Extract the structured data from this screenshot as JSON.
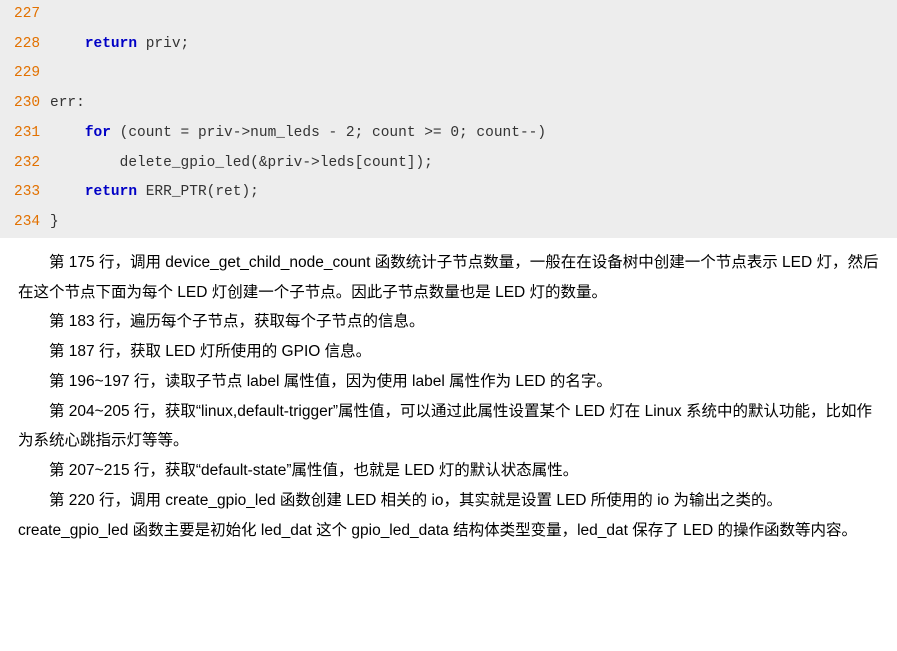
{
  "code": {
    "lines": [
      {
        "no": "227",
        "html": ""
      },
      {
        "no": "228",
        "html": "    <span class='kw'>return</span> priv;"
      },
      {
        "no": "229",
        "html": ""
      },
      {
        "no": "230",
        "html": "err:"
      },
      {
        "no": "231",
        "html": "    <span class='kw'>for</span> (count <span class='op'>=</span> priv<span class='op'>-&gt;</span>num_leds <span class='op'>-</span> 2; count <span class='op'>&gt;=</span> 0; count<span class='op'>--</span>)"
      },
      {
        "no": "232",
        "html": "        delete_gpio_led(<span class='op'>&amp;</span>priv<span class='op'>-&gt;</span>leds[count]);"
      },
      {
        "no": "233",
        "html": "    <span class='kw'>return</span> ERR_PTR(ret);"
      },
      {
        "no": "234",
        "html": "<span class='op'>}</span>"
      }
    ]
  },
  "prose": {
    "p1": "第 175 行，调用 device_get_child_node_count 函数统计子节点数量，一般在在设备树中创建一个节点表示 LED 灯，然后在这个节点下面为每个 LED 灯创建一个子节点。因此子节点数量也是 LED 灯的数量。",
    "p2": "第 183 行，遍历每个子节点，获取每个子节点的信息。",
    "p3": "第 187 行，获取 LED 灯所使用的 GPIO 信息。",
    "p4": "第 196~197 行，读取子节点 label 属性值，因为使用 label 属性作为 LED 的名字。",
    "p5": "第 204~205 行，获取“linux,default-trigger”属性值，可以通过此属性设置某个 LED 灯在 Linux 系统中的默认功能，比如作为系统心跳指示灯等等。",
    "p6": "第 207~215 行，获取“default-state”属性值，也就是 LED 灯的默认状态属性。",
    "p7": "第 220 行，调用 create_gpio_led 函数创建 LED 相关的 io，其实就是设置 LED 所使用的 io 为输出之类的。create_gpio_led 函数主要是初始化 led_dat 这个 gpio_led_data 结构体类型变量，led_dat 保存了 LED 的操作函数等内容。"
  }
}
